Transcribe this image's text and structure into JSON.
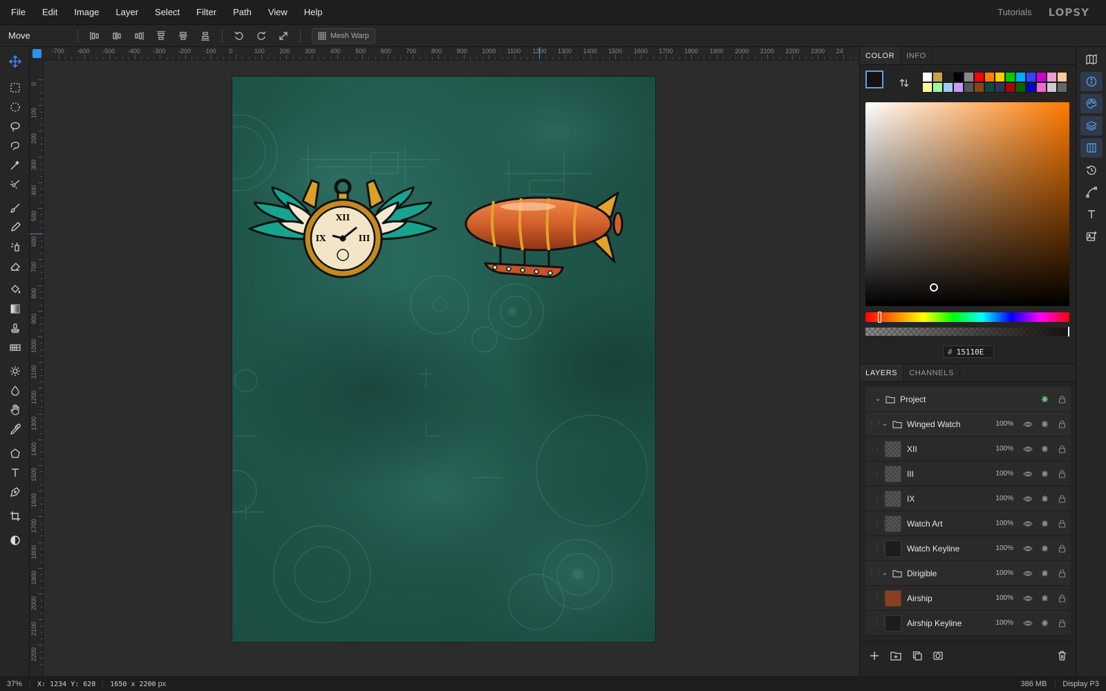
{
  "menubar": {
    "items": [
      "File",
      "Edit",
      "Image",
      "Layer",
      "Select",
      "Filter",
      "Path",
      "View",
      "Help"
    ],
    "tutorials": "Tutorials",
    "logo": "LOPSY"
  },
  "options": {
    "tool_name": "Move",
    "mesh_warp": "Mesh Warp"
  },
  "tools": [
    "move-tool",
    "rect-marquee-tool",
    "ellipse-marquee-tool",
    "lasso-tool",
    "magnetic-lasso-tool",
    "magic-wand-tool",
    "quick-select-tool",
    "brush-tool",
    "pencil-tool",
    "clone-tool",
    "eraser-tool",
    "fill-tool",
    "gradient-tool",
    "stamp-tool",
    "pattern-tool",
    "dodge-tool",
    "blur-tool",
    "hand-tool",
    "eyedropper-tool",
    "shape-tool",
    "text-tool",
    "pen-tool",
    "crop-tool",
    "contrast-tool"
  ],
  "ruler": {
    "top_labels": [
      "-700",
      "-600",
      "-500",
      "-400",
      "-300",
      "-200",
      "-100",
      "0",
      "100",
      "200",
      "300",
      "400",
      "500",
      "600",
      "700",
      "800",
      "900",
      "1000",
      "1100",
      "1200",
      "1300",
      "1400",
      "1500",
      "1600",
      "1700",
      "1800",
      "1900",
      "2000",
      "2100",
      "2200",
      "2300",
      "24"
    ],
    "left_labels": [
      "0",
      "100",
      "200",
      "300",
      "400",
      "500",
      "600",
      "700",
      "800",
      "900",
      "1000",
      "1100",
      "1200",
      "1300",
      "1400",
      "1500",
      "1600",
      "1700",
      "1800",
      "1900",
      "2000",
      "2100",
      "2200"
    ],
    "cursor_marker_x": "1200",
    "cursor_marker_y": "600"
  },
  "color_panel": {
    "tabs": [
      "COLOR",
      "INFO"
    ],
    "foreground": "#15110e",
    "background": "#ffffff",
    "hex_prefix": "#",
    "hex_value": "15110E",
    "hue_base": "#ff7a00",
    "swatches": [
      "#ffffff",
      "#c8a24a",
      "#202020",
      "#000000",
      "#888888",
      "#ff0000",
      "#ff7f00",
      "#ffcc00",
      "#00cc00",
      "#00aaff",
      "#3344ff",
      "#cc00cc",
      "#ff99cc",
      "#ffcc99",
      "#ffff99",
      "#99ff99",
      "#99ccff",
      "#cc99ff",
      "#555555",
      "#8b4513",
      "#0a4a44",
      "#333355",
      "#aa0000",
      "#006600",
      "#0000cc",
      "#ff66cc",
      "#cccccc",
      "#666666"
    ]
  },
  "layers_panel": {
    "tabs": [
      "LAYERS",
      "CHANNELS"
    ],
    "rows": [
      {
        "name": "Project",
        "kind": "group-root",
        "opacity": ""
      },
      {
        "name": "Winged Watch",
        "kind": "group",
        "opacity": "100%"
      },
      {
        "name": "XII",
        "kind": "layer",
        "opacity": "100%"
      },
      {
        "name": "III",
        "kind": "layer",
        "opacity": "100%"
      },
      {
        "name": "IX",
        "kind": "layer",
        "opacity": "100%"
      },
      {
        "name": "Watch Art",
        "kind": "layer",
        "opacity": "100%"
      },
      {
        "name": "Watch Keyline",
        "kind": "layer",
        "opacity": "100%"
      },
      {
        "name": "Dirigible",
        "kind": "group",
        "opacity": "100%"
      },
      {
        "name": "Airship",
        "kind": "layer",
        "opacity": "100%"
      },
      {
        "name": "Airship Keyline",
        "kind": "layer",
        "opacity": "100%"
      }
    ]
  },
  "canvas_art": {
    "watch_numerals": [
      "XII",
      "IX",
      "III"
    ]
  },
  "status": {
    "zoom": "37%",
    "x_label": "X:",
    "x_value": "1234",
    "y_label": "Y:",
    "y_value": "628",
    "dimensions": "1650 x 2200",
    "unit": "px",
    "memory": "386 MB",
    "display": "Display P3"
  }
}
